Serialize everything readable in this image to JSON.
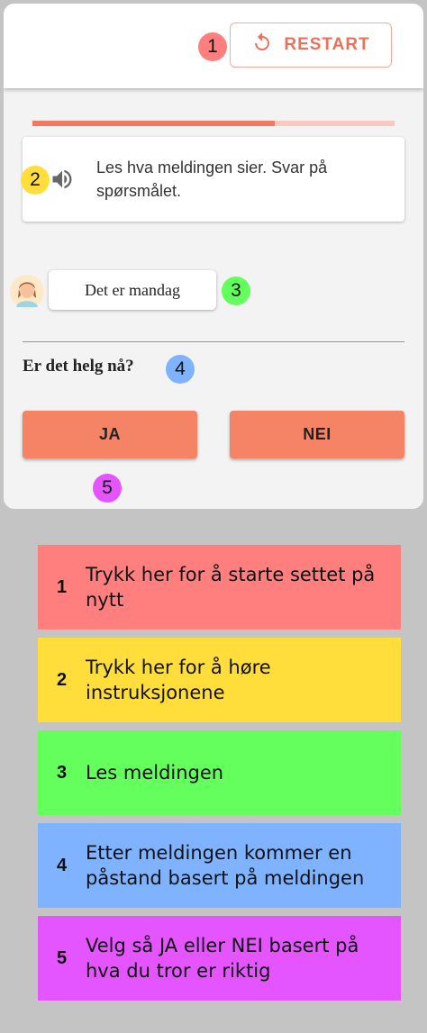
{
  "header": {
    "restart_label": "RESTART"
  },
  "progress": {
    "fraction": 0.67
  },
  "instruction": {
    "speaker_icon": "speaker-icon",
    "text": "Les hva meldingen sier. Svar på spørsmålet."
  },
  "message": {
    "avatar_icon": "person-avatar",
    "text": "Det er mandag"
  },
  "statement": {
    "text": "Er det helg nå?"
  },
  "answers": {
    "yes": "JA",
    "no": "NEI"
  },
  "badges": [
    "1",
    "2",
    "3",
    "4",
    "5"
  ],
  "legend": [
    {
      "num": "1",
      "text": "Trykk her for å starte settet på nytt",
      "color": "#ff7f7f"
    },
    {
      "num": "2",
      "text": "Trykk her for å høre instruksjonene",
      "color": "#ffde3b"
    },
    {
      "num": "3",
      "text": "Les meldingen",
      "color": "#64ff5c"
    },
    {
      "num": "4",
      "text": "Etter meldingen kommer en påstand basert på meldingen",
      "color": "#7fb3ff"
    },
    {
      "num": "5",
      "text": "Velg så JA eller NEI basert på hva du tror er riktig",
      "color": "#e455ff"
    }
  ],
  "colors": {
    "accent": "#ef7059",
    "button": "#f58467",
    "badge1": "#ff7f7f",
    "badge2": "#ffde3b",
    "badge3": "#64ff5c",
    "badge4": "#7fb3ff",
    "badge5": "#e455ff"
  }
}
